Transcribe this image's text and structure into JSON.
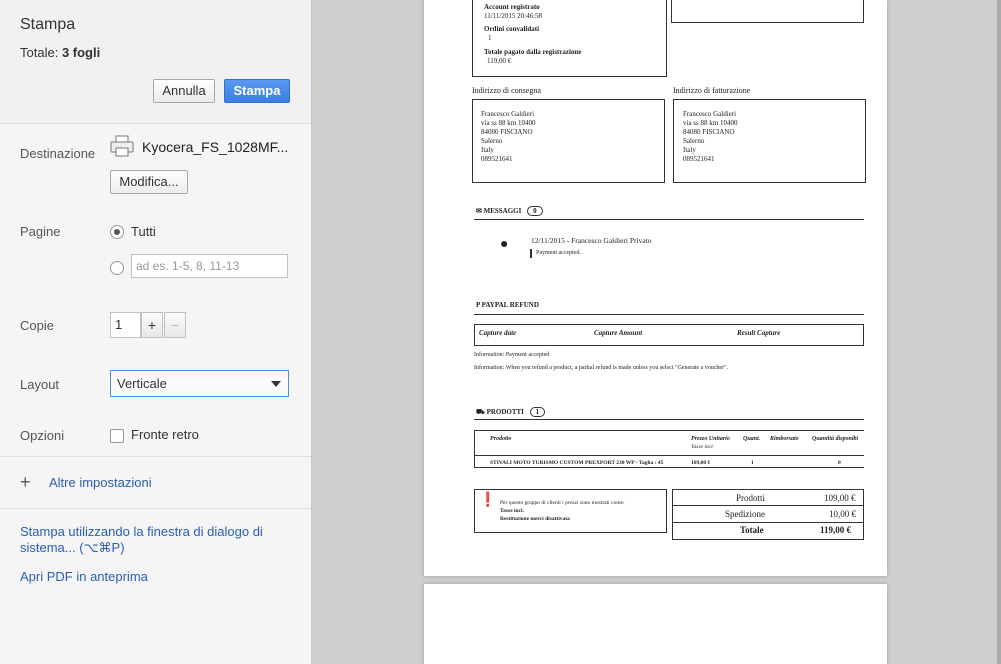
{
  "header": {
    "title": "Stampa",
    "total_label": "Totale:",
    "total_value": "3 fogli",
    "cancel_label": "Annulla",
    "print_label": "Stampa"
  },
  "destination": {
    "label": "Destinazione",
    "printer_name": "Kyocera_FS_1028MF...",
    "modify_label": "Modifica..."
  },
  "pages": {
    "label": "Pagine",
    "all_label": "Tutti",
    "range_placeholder": "ad es. 1-5, 8, 11-13"
  },
  "copies": {
    "label": "Copie",
    "value": "1",
    "plus": "+",
    "minus": "−"
  },
  "layout": {
    "label": "Layout",
    "selected": "Verticale"
  },
  "options": {
    "label": "Opzioni",
    "duplex_label": "Fronte retro"
  },
  "more_settings": {
    "label": "Altre impostazioni"
  },
  "links": {
    "system_dialog": "Stampa utilizzando la finestra di dialogo di sistema... (⌥⌘P)",
    "open_pdf": "Apri PDF in anteprima"
  },
  "preview": {
    "account_registered": "Account registrato",
    "account_date": "11/11/2015 20:46:58",
    "validated_orders": "Ordini convalidati",
    "validated_count": "1",
    "total_paid_label": "Totale pagato dalla registrazione",
    "total_paid_value": "119,00 €",
    "shipping_address_label": "Indirizzo di consegna",
    "billing_address_label": "Indirizzo di fatturazione",
    "address_lines": [
      "Francesco Galdieri",
      "via ss 88 km 10400",
      "84080 FISCIANO",
      "Salerno",
      "Italy",
      "089521641"
    ],
    "messages_label": "MESSAGGI",
    "messages_count": "0",
    "message_meta": "12/11/2015 - Francesco Galdieri  Privato",
    "message_text": "Payment accepted.",
    "paypal_label": "PAYPAL REFUND",
    "paypal_cols": [
      "Capture date",
      "Capture Amount",
      "Result Capture"
    ],
    "info1": "Information: Payment accepted",
    "info2": "Information: When you refund a product, a partial refund is made unless you select \"Generate a voucher\".",
    "products_label": "PRODOTTI",
    "products_count": "1",
    "product_cols": [
      "Prodotto",
      "Prezzo Unitario",
      "Tasse incl.",
      "Quant.",
      "Rimborsato",
      "Quantità disponibi"
    ],
    "product_name": "STIVALI MOTO TURISMO CUSTOM PREXPORT 230 WP - Taglia : 45",
    "product_price": "109,00 €",
    "product_qty": "1",
    "product_available": "0",
    "notice_line1": "Per questo gruppo di clienti i prezzi sono mostrati come:",
    "notice_line2": "Tasse incl.",
    "notice_line3": "Restituzione merci disattivata",
    "sum_products_label": "Prodotti",
    "sum_products_value": "109,00 €",
    "sum_shipping_label": "Spedizione",
    "sum_shipping_value": "10,00 €",
    "sum_total_label": "Totale",
    "sum_total_value": "119,00 €"
  }
}
